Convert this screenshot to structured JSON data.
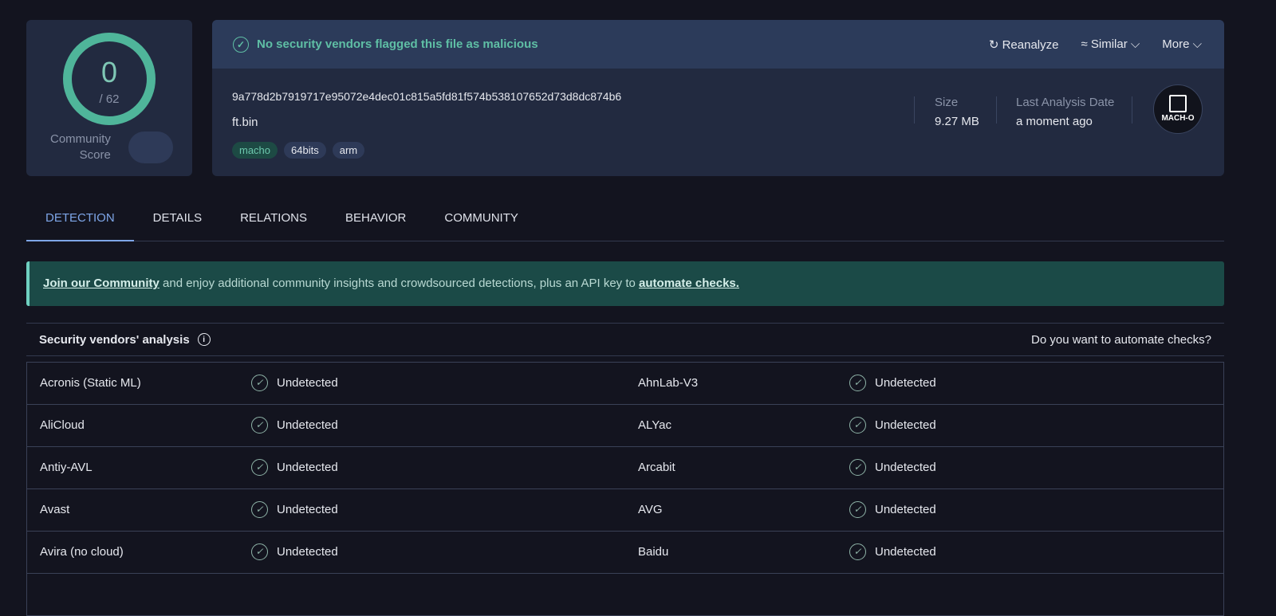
{
  "score": {
    "detections": "0",
    "total": "/ 62",
    "community_label_1": "Community",
    "community_label_2": "Score"
  },
  "status": {
    "message": "No security vendors flagged this file as malicious"
  },
  "actions": {
    "reanalyze": "Reanalyze",
    "similar": "Similar",
    "more": "More"
  },
  "file": {
    "hash": "9a778d2b7919717e95072e4dec01c815a5fd81f574b538107652d73d8dc874b6",
    "name": "ft.bin",
    "tags": [
      "macho",
      "64bits",
      "arm"
    ],
    "size_label": "Size",
    "size": "9.27 MB",
    "date_label": "Last Analysis Date",
    "date": "a moment ago",
    "type_badge": "MACH-O"
  },
  "tabs": [
    "DETECTION",
    "DETAILS",
    "RELATIONS",
    "BEHAVIOR",
    "COMMUNITY"
  ],
  "banner": {
    "link1": "Join our Community",
    "text": " and enjoy additional community insights and crowdsourced detections, plus an API key to ",
    "link2": "automate checks."
  },
  "section": {
    "title": "Security vendors' analysis",
    "right": "Do you want to automate checks?"
  },
  "rows": [
    {
      "v1": "Acronis (Static ML)",
      "r1": "Undetected",
      "v2": "AhnLab-V3",
      "r2": "Undetected"
    },
    {
      "v1": "AliCloud",
      "r1": "Undetected",
      "v2": "ALYac",
      "r2": "Undetected"
    },
    {
      "v1": "Antiy-AVL",
      "r1": "Undetected",
      "v2": "Arcabit",
      "r2": "Undetected"
    },
    {
      "v1": "Avast",
      "r1": "Undetected",
      "v2": "AVG",
      "r2": "Undetected"
    },
    {
      "v1": "Avira (no cloud)",
      "r1": "Undetected",
      "v2": "Baidu",
      "r2": "Undetected"
    }
  ]
}
